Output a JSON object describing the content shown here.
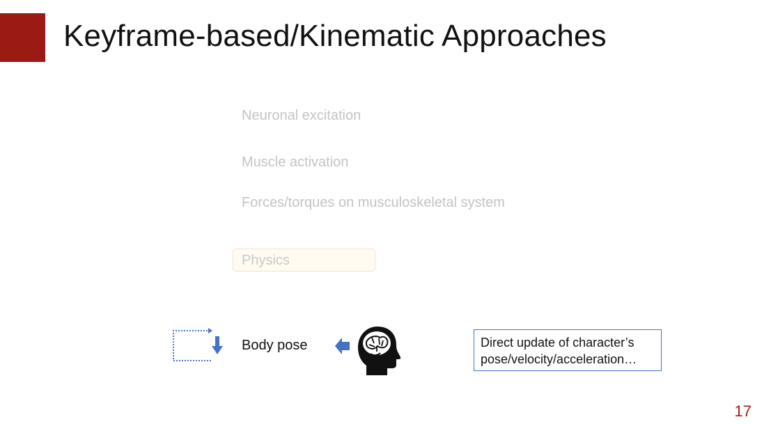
{
  "slide": {
    "title": "Keyframe-based/Kinematic Approaches",
    "accent_color": "#9c1a14",
    "page_number": "17"
  },
  "levels": {
    "neuronal": "Neuronal excitation",
    "muscle": "Muscle activation",
    "forces": "Forces/torques on musculoskeletal system",
    "physics": "Physics",
    "body_pose": "Body pose"
  },
  "note": {
    "line1": "Direct update of character’s",
    "line2": "pose/velocity/acceleration…",
    "border_color": "#4472c4"
  },
  "icons": {
    "loop": "loop-arrow-icon",
    "arrow": "left-arrow-icon",
    "brain": "brain-head-icon"
  }
}
